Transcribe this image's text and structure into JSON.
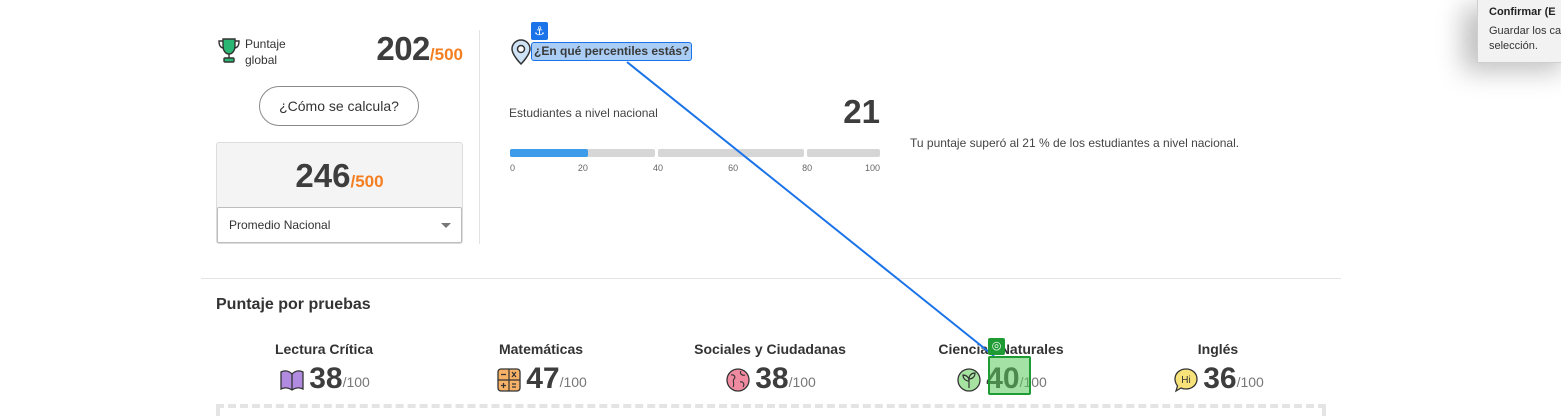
{
  "global_score": {
    "label": "Puntaje global",
    "value": "202",
    "max": "/500",
    "how_button": "¿Cómo se calcula?"
  },
  "average": {
    "value": "246",
    "max": "/500",
    "selected": "Promedio Nacional"
  },
  "percentile": {
    "link_text": "¿En qué percentiles estás?",
    "national_label": "Estudiantes a nivel nacional",
    "national_value": "21",
    "bar_fill_percent": 21,
    "ticks": [
      "0",
      "20",
      "40",
      "60",
      "80",
      "100"
    ],
    "summary": "Tu puntaje superó al 21 % de los estudiantes a nivel nacional."
  },
  "tooltip": {
    "title": "Confirmar (E",
    "body_line1": "Guardar los ca",
    "body_line2": "selección."
  },
  "tests": {
    "title": "Puntaje por pruebas",
    "items": [
      {
        "name": "Lectura Crítica",
        "score": "38",
        "max": "/100",
        "icon": "book-icon"
      },
      {
        "name": "Matemáticas",
        "score": "47",
        "max": "/100",
        "icon": "calculator-icon"
      },
      {
        "name": "Sociales y Ciudadanas",
        "score": "38",
        "max": "/100",
        "icon": "globe-icon"
      },
      {
        "name": "Ciencias Naturales",
        "score": "40",
        "max": "/100",
        "icon": "leaf-icon"
      },
      {
        "name": "Inglés",
        "score": "36",
        "max": "/100",
        "icon": "speech-bubble-icon"
      }
    ]
  },
  "overlay": {
    "anchor_symbol": "⚓",
    "target_symbol": "◎",
    "accent": "#1a73e8",
    "target_color": "#1f9b33"
  },
  "colors": {
    "orange": "#f47e20",
    "bar_blue": "#3d9be9",
    "trophy_green": "#2bb673"
  }
}
